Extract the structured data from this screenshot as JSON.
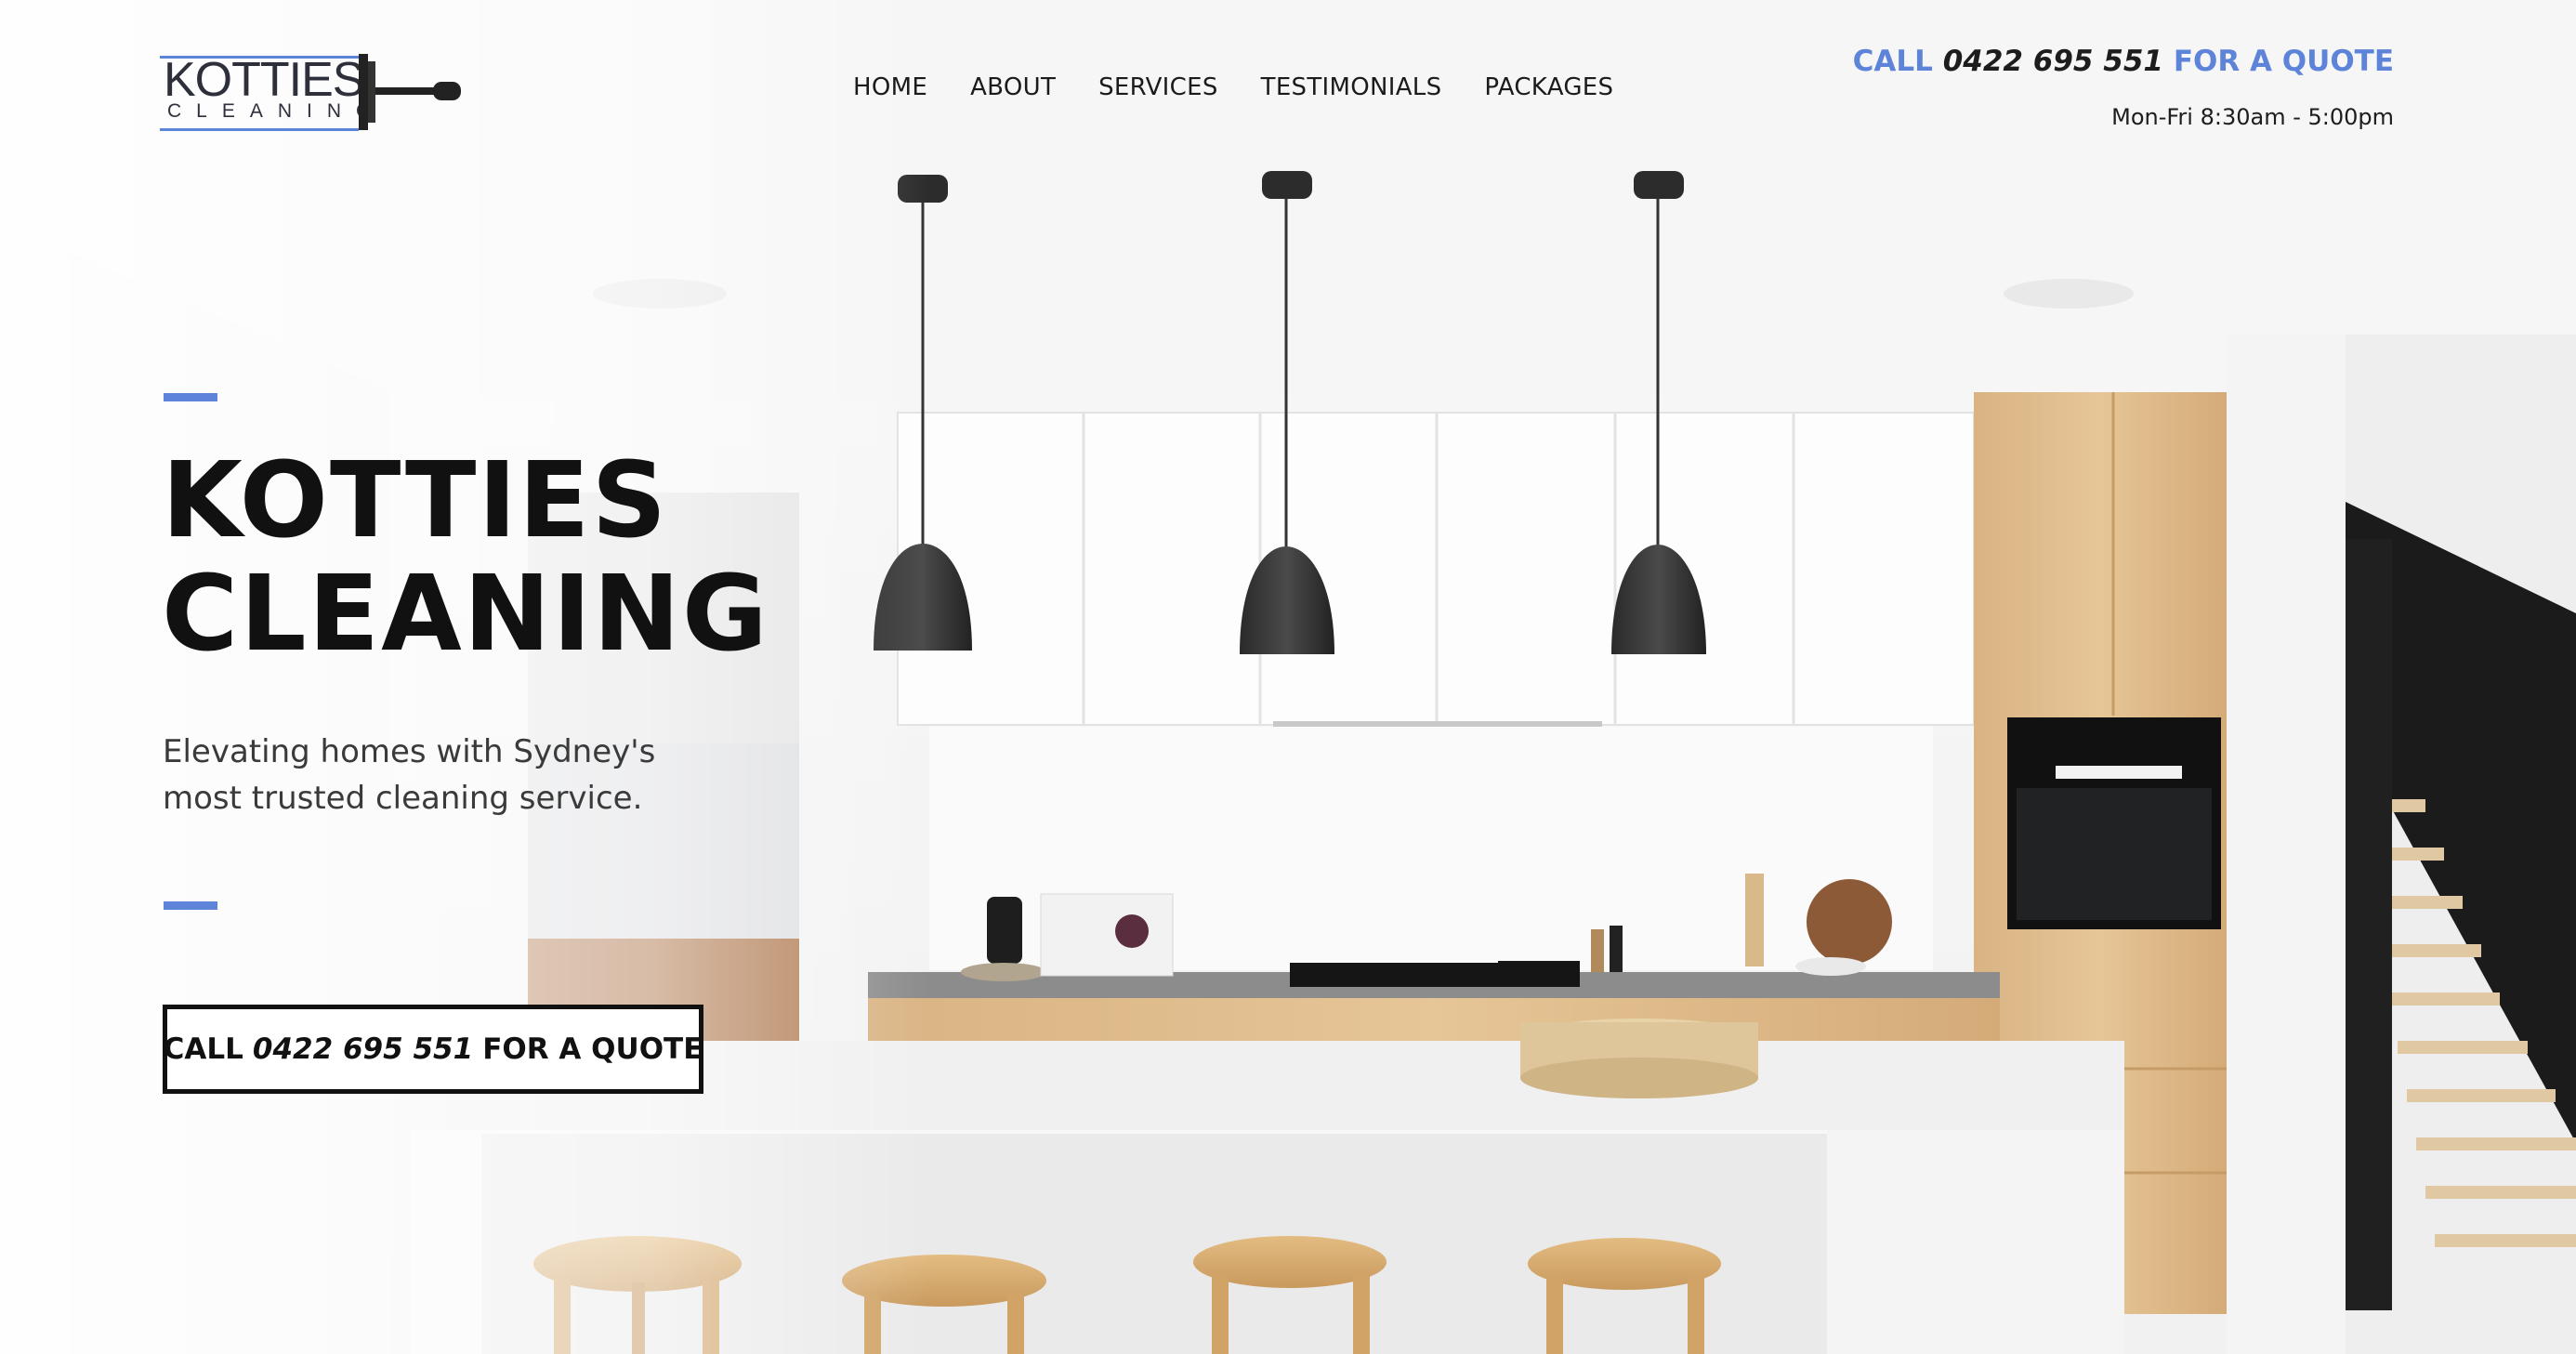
{
  "brand": {
    "name": "KOTTIES",
    "sub": "CLEANING",
    "accent_color": "#5e84d9"
  },
  "nav": {
    "items": [
      {
        "label": "HOME"
      },
      {
        "label": "ABOUT"
      },
      {
        "label": "SERVICES"
      },
      {
        "label": "TESTIMONIALS"
      },
      {
        "label": "PACKAGES"
      }
    ]
  },
  "header_call": {
    "prefix": "CALL",
    "phone": "0422 695 551",
    "suffix": "FOR A QUOTE",
    "hours": "Mon-Fri 8:30am - 5:00pm"
  },
  "hero": {
    "title_line1": "KOTTIES",
    "title_line2": "CLEANING",
    "tagline": "Elevating homes with Sydney's most trusted cleaning service.",
    "cta_prefix": "CALL",
    "cta_phone": "0422 695 551",
    "cta_suffix": "FOR A QUOTE"
  },
  "icons": {
    "logo_tool": "squeegee-icon"
  }
}
